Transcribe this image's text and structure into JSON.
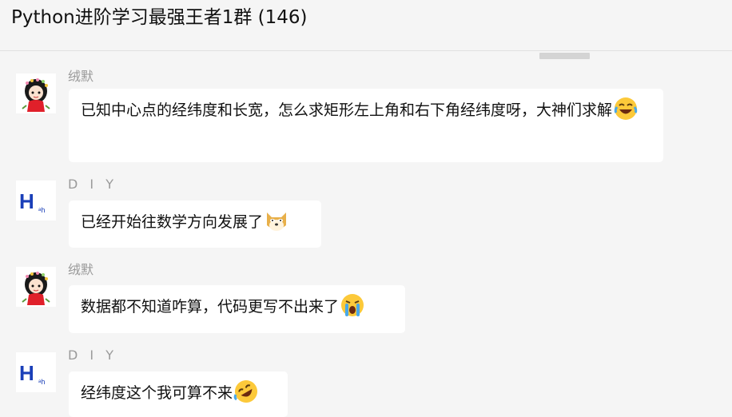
{
  "chat": {
    "title": "Python进阶学习最强王者1群 (146)"
  },
  "messages": [
    {
      "sender": "绒默",
      "text": "已知中心点的经纬度和长宽，怎么求矩形左上角和右下角经纬度呀，大神们求解",
      "emoji": "laughing-tears-emoji"
    },
    {
      "sender": "D I Y",
      "text": "已经开始往数学方向发展了",
      "emoji": "doge-emoji"
    },
    {
      "sender": "绒默",
      "text": "数据都不知道咋算，代码更写不出来了",
      "emoji": "loudly-crying-emoji"
    },
    {
      "sender": "D I Y",
      "text": "经纬度这个我可算不来",
      "emoji": "rolling-laughing-emoji"
    }
  ],
  "avatars": {
    "girl": {
      "shirt_color": "#e0202a",
      "hair_color": "#1a1a1a"
    },
    "diy": {
      "letter": "H",
      "small_text": "ᵃh",
      "color": "#1a3fb8"
    }
  }
}
